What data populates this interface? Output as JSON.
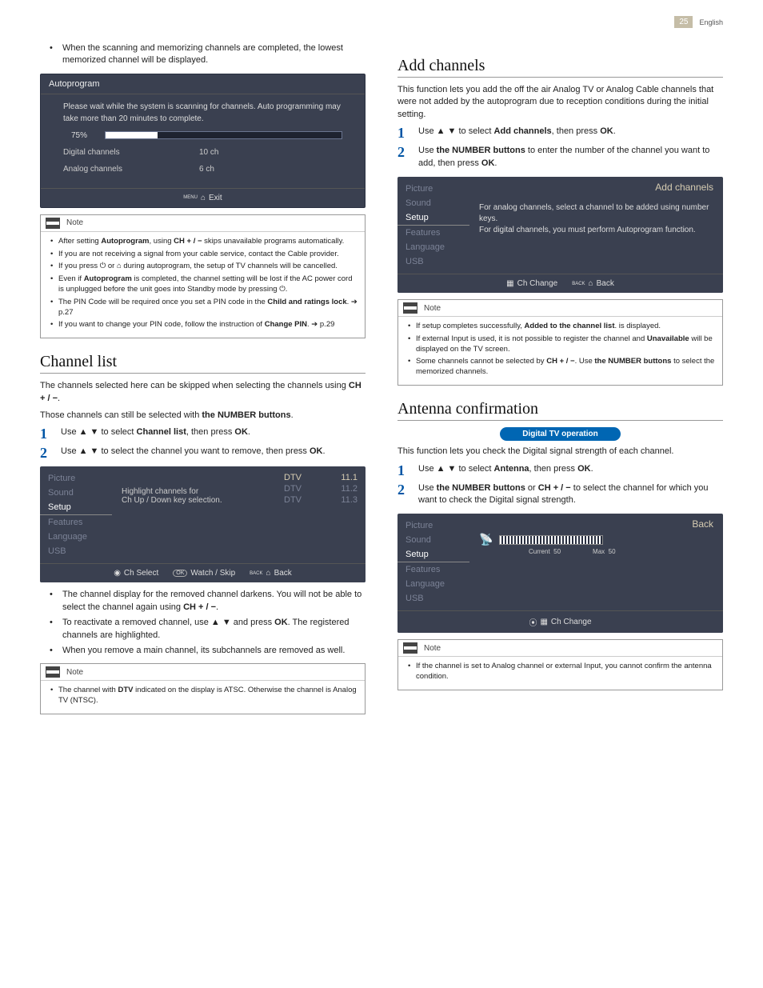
{
  "page": {
    "number": "25",
    "language": "English"
  },
  "left": {
    "intro_bullet": "When the scanning and memorizing channels are completed, the lowest memorized channel will be displayed.",
    "autoprogram": {
      "title": "Autoprogram",
      "wait_msg": "Please wait while the system is scanning for channels. Auto programming may take more than 20 minutes to complete.",
      "percent": "75%",
      "digital_label": "Digital channels",
      "digital_val": "10 ch",
      "analog_label": "Analog channels",
      "analog_val": "6 ch",
      "exit": "Exit",
      "menu_hint": "MENU"
    },
    "note1": {
      "label": "Note",
      "items": [
        "After setting <b>Autoprogram</b>, using <b>CH + / −</b> skips unavailable programs automatically.",
        "If you are not receiving a signal from your cable service, contact the Cable provider.",
        "If you press ⏻ or ⌂ during autoprogram, the setup of TV channels will be cancelled.",
        "Even if <b>Autoprogram</b> is completed, the channel setting will be lost if the AC power cord is unplugged before the unit goes into Standby mode by pressing ⏻.",
        "The PIN Code will be required once you set a PIN code in the <b>Child and ratings lock</b>. ➔ p.27",
        "If you want to change your PIN code, follow the instruction of <b>Change PIN</b>. ➔ p.29"
      ]
    },
    "channel_list": {
      "heading": "Channel list",
      "p1": "The channels selected here can be skipped when selecting the channels using <b>CH + / −</b>.",
      "p2": "Those channels can still be selected with <b>the NUMBER buttons</b>.",
      "step1": "Use ▲ ▼ to select <b>Channel list</b>, then press <b>OK</b>.",
      "step2": "Use ▲ ▼ to select the channel you want to remove, then press <b>OK</b>.",
      "screen": {
        "sidebar": [
          "Picture",
          "Sound",
          "Setup",
          "Features",
          "Language",
          "USB"
        ],
        "msg1": "Highlight channels for",
        "msg2": "Ch Up / Down key selection.",
        "rows": [
          {
            "type": "DTV",
            "ch": "11.1"
          },
          {
            "type": "DTV",
            "ch": "11.2"
          },
          {
            "type": "DTV",
            "ch": "11.3"
          }
        ],
        "footer": {
          "a": "Ch Select",
          "b": "Watch / Skip",
          "c": "Back",
          "back_hint": "BACK"
        }
      },
      "post_bullets": [
        "The channel display for the removed channel darkens. You will not be able to select the channel again using <b>CH + / −</b>.",
        "To reactivate a removed channel, use ▲ ▼ and press <b>OK</b>. The registered channels are highlighted.",
        "When you remove a main channel, its subchannels are removed as well."
      ]
    },
    "note2": {
      "label": "Note",
      "items": [
        "The channel with <b>DTV</b> indicated on the display is ATSC. Otherwise the channel is Analog TV (NTSC)."
      ]
    }
  },
  "right": {
    "add_channels": {
      "heading": "Add channels",
      "intro": "This function lets you add the off the air Analog TV or Analog Cable channels that were not added by the autoprogram due to reception conditions during the initial setting.",
      "step1": "Use ▲ ▼ to select <b>Add channels</b>, then press <b>OK</b>.",
      "step2": "Use <b>the NUMBER buttons</b> to enter the number of the channel you want to add, then press <b>OK</b>.",
      "screen": {
        "sidebar": [
          "Picture",
          "Sound",
          "Setup",
          "Features",
          "Language",
          "USB"
        ],
        "top_right": "Add channels",
        "msg": "For analog channels, select a channel to be added using number keys.\nFor digital channels, you must perform Autoprogram function.",
        "footer": {
          "a": "Ch Change",
          "b": "Back",
          "back_hint": "BACK"
        }
      }
    },
    "note3": {
      "label": "Note",
      "items": [
        "If setup completes successfully, <b>Added to the channel list</b>. is displayed.",
        "If external Input is used, it is not possible to register the channel and <b>Unavailable</b> will be displayed on the TV screen.",
        "Some channels cannot be selected by <b>CH + / −</b>. Use <b>the NUMBER buttons</b> to select the memorized channels."
      ]
    },
    "antenna": {
      "heading": "Antenna confirmation",
      "pill": "Digital TV operation",
      "intro": "This function lets you check the Digital signal strength of each channel.",
      "step1": "Use ▲ ▼ to select <b>Antenna</b>, then press <b>OK</b>.",
      "step2": "Use <b>the NUMBER buttons</b> or <b>CH + / −</b> to select the channel for which you want to check the Digital signal strength.",
      "screen": {
        "sidebar": [
          "Picture",
          "Sound",
          "Setup",
          "Features",
          "Language",
          "USB"
        ],
        "top_right": "Back",
        "current": "Current",
        "cur_val": "50",
        "max": "Max",
        "max_val": "50",
        "footer": {
          "a": "Ch Change"
        }
      }
    },
    "note4": {
      "label": "Note",
      "items": [
        "If the channel is set to Analog channel or external Input, you cannot confirm the antenna condition."
      ]
    }
  }
}
